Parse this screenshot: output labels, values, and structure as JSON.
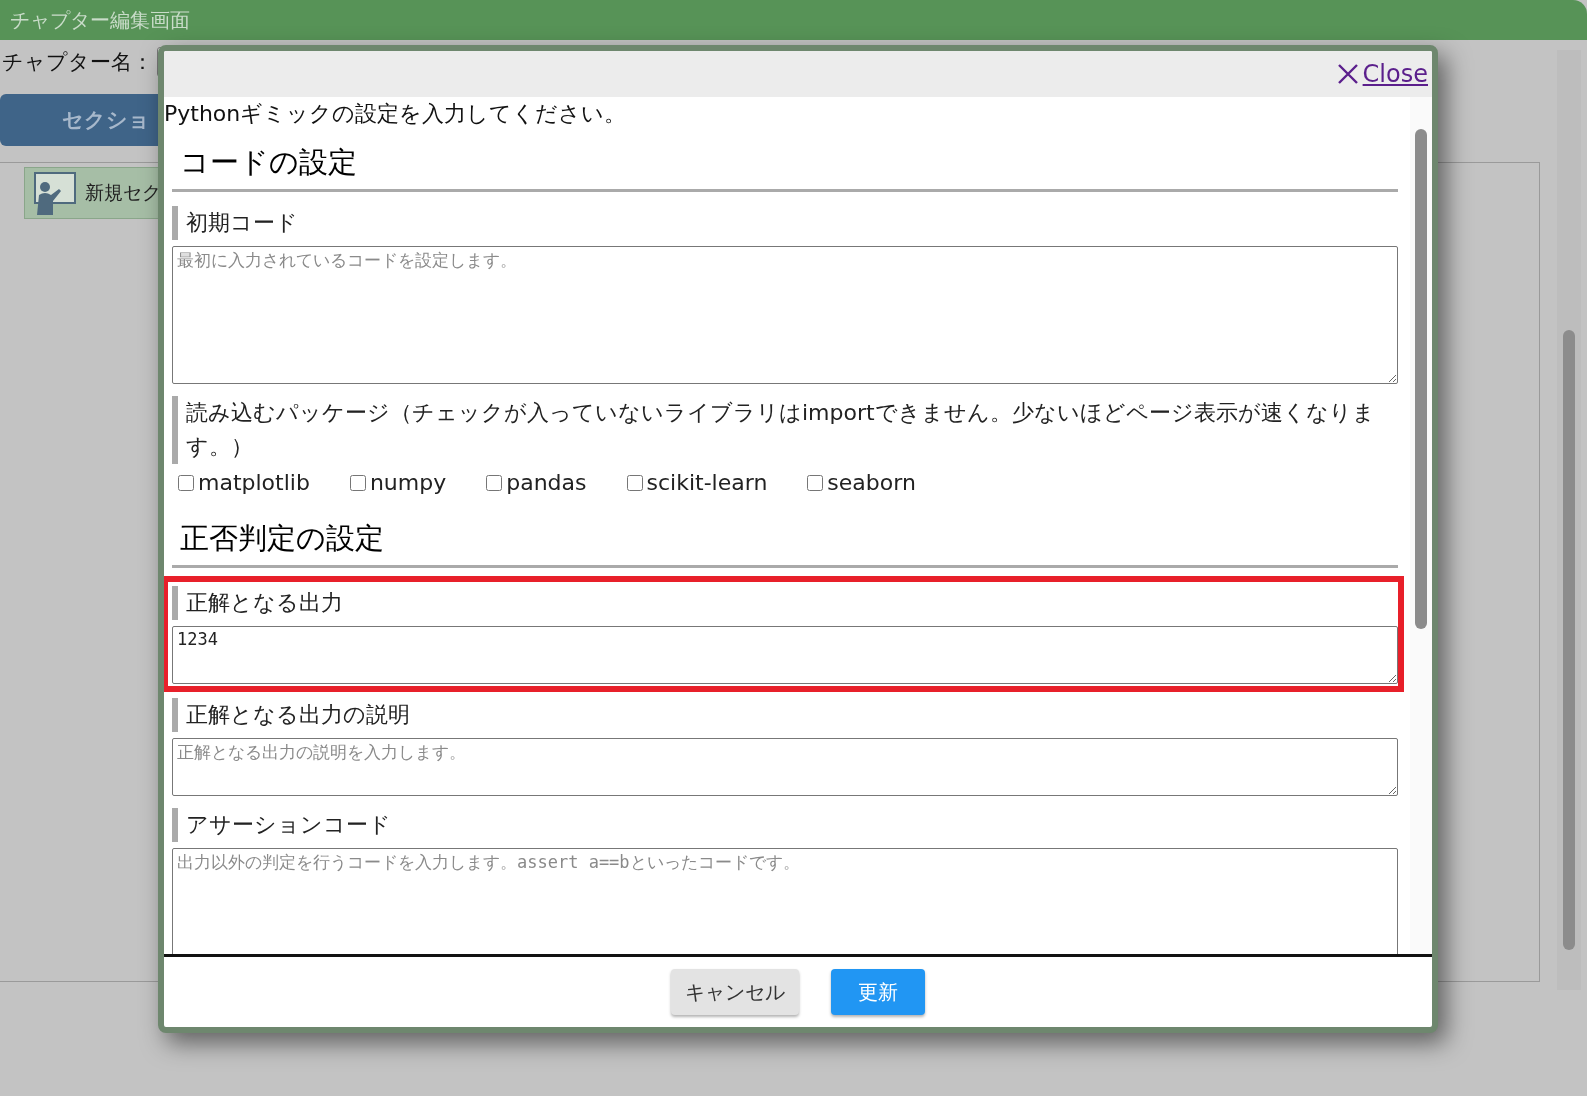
{
  "page": {
    "title": "チャプター編集画面",
    "chapter_name_label": "チャプター名：",
    "section_button": "セクショ",
    "section_item": "新規セク"
  },
  "dialog": {
    "close_label": "Close",
    "intro": "Pythonギミックの設定を入力してください。",
    "sections": [
      {
        "heading": "コードの設定",
        "fields": [
          {
            "kind": "tall",
            "label": "初期コード",
            "placeholder": "最初に入力されているコードを設定します。",
            "highlighted": false
          },
          {
            "kind": "checkboxes",
            "label": "読み込むパッケージ（チェックが入っていないライブラリはimportできません。少ないほどページ表示が速くなります。）",
            "highlighted": false,
            "options": [
              {
                "label": "matplotlib",
                "checked": false
              },
              {
                "label": "numpy",
                "checked": false
              },
              {
                "label": "pandas",
                "checked": false
              },
              {
                "label": "scikit-learn",
                "checked": false
              },
              {
                "label": "seaborn",
                "checked": false
              }
            ]
          }
        ]
      },
      {
        "heading": "正否判定の設定",
        "fields": [
          {
            "kind": "short",
            "label": "正解となる出力",
            "value": "1234",
            "highlighted": true
          },
          {
            "kind": "short",
            "label": "正解となる出力の説明",
            "placeholder": "正解となる出力の説明を入力します。",
            "highlighted": false
          },
          {
            "kind": "tall",
            "label": "アサーションコード",
            "placeholder": "出力以外の判定を行うコードを入力します。assert a==bといったコードです。",
            "highlighted": false
          }
        ]
      }
    ],
    "buttons": [
      {
        "label": "キャンセル",
        "kind": "secondary"
      },
      {
        "label": "更新",
        "kind": "primary"
      }
    ]
  }
}
